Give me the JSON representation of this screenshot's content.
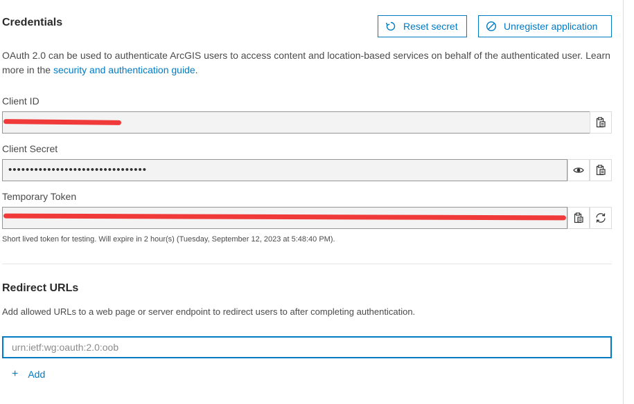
{
  "credentials": {
    "title": "Credentials",
    "reset_secret_label": "Reset secret",
    "unregister_label": "Unregister application",
    "description_text": "OAuth 2.0 can be used to authenticate ArcGIS users to access content and location-based services on behalf of the authenticated user. Learn more in the ",
    "description_link": "security and authentication guide",
    "description_suffix": ".",
    "client_id_label": "Client ID",
    "client_id_value": "",
    "client_secret_label": "Client Secret",
    "client_secret_value": "••••••••••••••••••••••••••••••••",
    "temp_token_label": "Temporary Token",
    "temp_token_value": "",
    "token_helper": "Short lived token for testing. Will expire in 2 hour(s) (Tuesday, September 12, 2023 at 5:48:40 PM)."
  },
  "redirect": {
    "title": "Redirect URLs",
    "description": "Add allowed URLs to a web page or server endpoint to redirect users to after completing authentication.",
    "input_placeholder": "urn:ietf:wg:oauth:2.0:oob",
    "add_label": "Add"
  },
  "icons": {
    "reset": "rotate-icon",
    "unregister": "prohibit-icon",
    "copy": "clipboard-icon",
    "show": "eye-icon",
    "refresh": "refresh-icon",
    "add": "plus-icon"
  },
  "colors": {
    "accent": "#007ac2",
    "redaction": "#f03a3a"
  }
}
